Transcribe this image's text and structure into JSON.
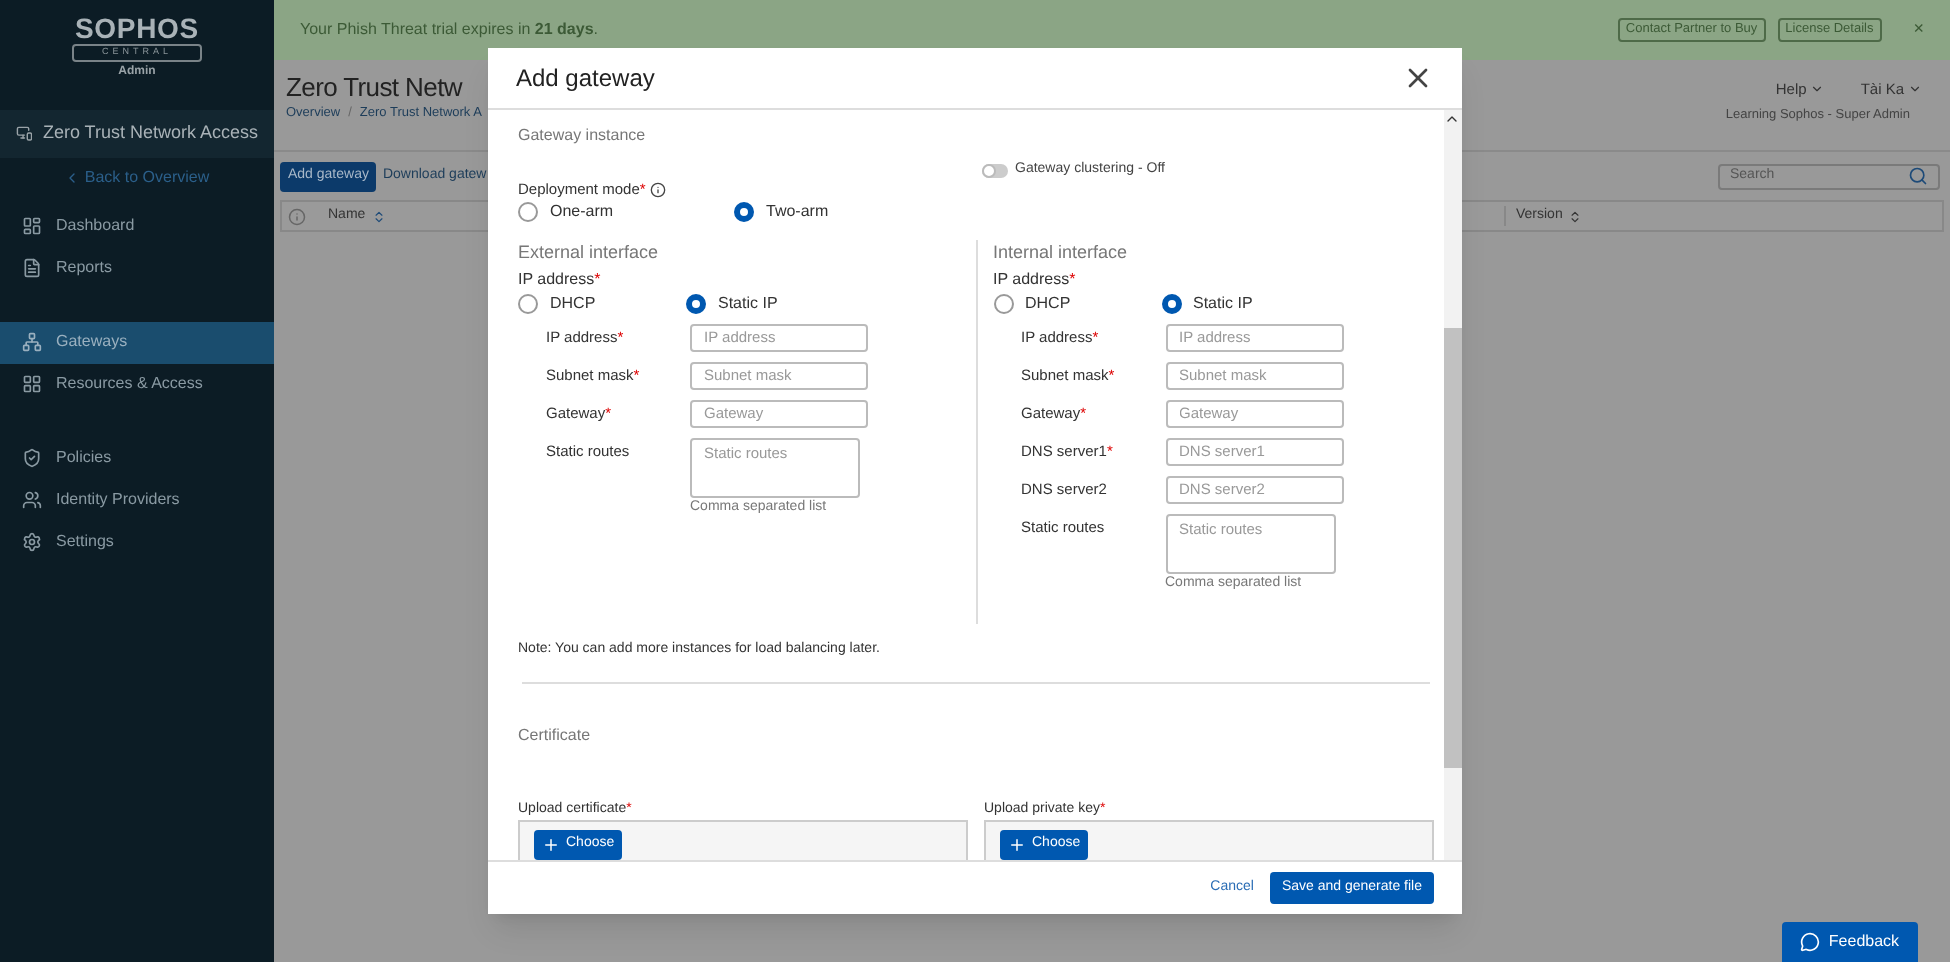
{
  "banner": {
    "text": "Your Phish Threat trial expires in **21 days**.",
    "buttons": [
      "Contact Partner to Buy",
      "License Details"
    ],
    "close": "×"
  },
  "sidebar": {
    "logo": "SOPHOS",
    "logo_sub": "CENTRAL",
    "role": "Admin",
    "product": "Zero Trust Network Access",
    "back": "Back to Overview",
    "groups": [
      [
        {
          "label": "Dashboard",
          "kind": "dashboard",
          "selected": false
        },
        {
          "label": "Reports",
          "kind": "reports",
          "selected": false
        }
      ],
      [
        {
          "label": "Gateways",
          "kind": "gateways",
          "selected": true
        },
        {
          "label": "Resources & Access",
          "kind": "resources",
          "selected": false
        }
      ],
      [
        {
          "label": "Policies",
          "kind": "policies",
          "selected": false
        },
        {
          "label": "Identity Providers",
          "kind": "identity",
          "selected": false
        },
        {
          "label": "Settings",
          "kind": "settings",
          "selected": false
        }
      ]
    ]
  },
  "header": {
    "title": "Zero Trust Netw",
    "breadcrumbs": [
      "Overview",
      "Zero Trust Network A"
    ],
    "separator": "/",
    "help": "Help",
    "user": "Tài Ka",
    "account": "Learning Sophos - Super Admin"
  },
  "toolbar": {
    "add": "Add gateway",
    "download": "Download gatew",
    "search": {
      "placeholder": "Search"
    }
  },
  "table": {
    "columns": [
      "Name",
      "Version"
    ]
  },
  "modal": {
    "title": "Add gateway",
    "section": "Gateway instance",
    "deployment": {
      "label": "Deployment mode",
      "required": true,
      "options": [
        {
          "label": "One-arm",
          "selected": false
        },
        {
          "label": "Two-arm",
          "selected": true
        }
      ]
    },
    "clustering": {
      "label": "Gateway clustering - Off",
      "on": false
    },
    "interfaces": [
      {
        "title": "External interface",
        "ip_label": "IP address",
        "required": true,
        "options": [
          {
            "label": "DHCP",
            "selected": false
          },
          {
            "label": "Static IP",
            "selected": true
          }
        ],
        "fields": [
          {
            "label": "IP address",
            "required": true,
            "placeholder": "IP address",
            "kind": "input"
          },
          {
            "label": "Subnet mask",
            "required": true,
            "placeholder": "Subnet mask",
            "kind": "input"
          },
          {
            "label": "Gateway",
            "required": true,
            "placeholder": "Gateway",
            "kind": "input"
          },
          {
            "label": "Static routes",
            "required": false,
            "placeholder": "Static routes",
            "kind": "textarea",
            "hint": "Comma separated list"
          }
        ]
      },
      {
        "title": "Internal interface",
        "ip_label": "IP address",
        "required": true,
        "options": [
          {
            "label": "DHCP",
            "selected": false
          },
          {
            "label": "Static IP",
            "selected": true
          }
        ],
        "fields": [
          {
            "label": "IP address",
            "required": true,
            "placeholder": "IP address",
            "kind": "input"
          },
          {
            "label": "Subnet mask",
            "required": true,
            "placeholder": "Subnet mask",
            "kind": "input"
          },
          {
            "label": "Gateway",
            "required": true,
            "placeholder": "Gateway",
            "kind": "input"
          },
          {
            "label": "DNS server1",
            "required": true,
            "placeholder": "DNS server1",
            "kind": "input"
          },
          {
            "label": "DNS server2",
            "required": false,
            "placeholder": "DNS server2",
            "kind": "input"
          },
          {
            "label": "Static routes",
            "required": false,
            "placeholder": "Static routes",
            "kind": "textarea",
            "hint": "Comma separated list"
          }
        ]
      }
    ],
    "note": "Note: You can add more instances for load balancing later.",
    "certificate": {
      "title": "Certificate",
      "uploads": [
        {
          "label": "Upload certificate",
          "required": true,
          "button": "Choose"
        },
        {
          "label": "Upload private key",
          "required": true,
          "button": "Choose"
        }
      ]
    },
    "cancel": "Cancel",
    "save": "Save and generate file"
  },
  "feedback": "Feedback",
  "required_mark": "*"
}
